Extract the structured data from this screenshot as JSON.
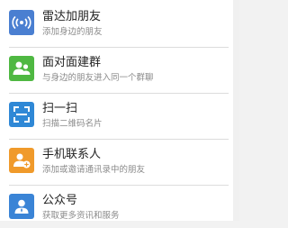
{
  "items": [
    {
      "title": "雷达加朋友",
      "subtitle": "添加身边的朋友",
      "icon": "radar-icon",
      "color": "#4a7fd1"
    },
    {
      "title": "面对面建群",
      "subtitle": "与身边的朋友进入同一个群聊",
      "icon": "face-to-face-group-icon",
      "color": "#4fb842"
    },
    {
      "title": "扫一扫",
      "subtitle": "扫描二维码名片",
      "icon": "scan-icon",
      "color": "#2f88d6"
    },
    {
      "title": "手机联系人",
      "subtitle": "添加或邀请通讯录中的朋友",
      "icon": "phone-contacts-icon",
      "color": "#f09a2b"
    },
    {
      "title": "公众号",
      "subtitle": "获取更多资讯和服务",
      "icon": "official-account-icon",
      "color": "#3a84d6"
    }
  ]
}
